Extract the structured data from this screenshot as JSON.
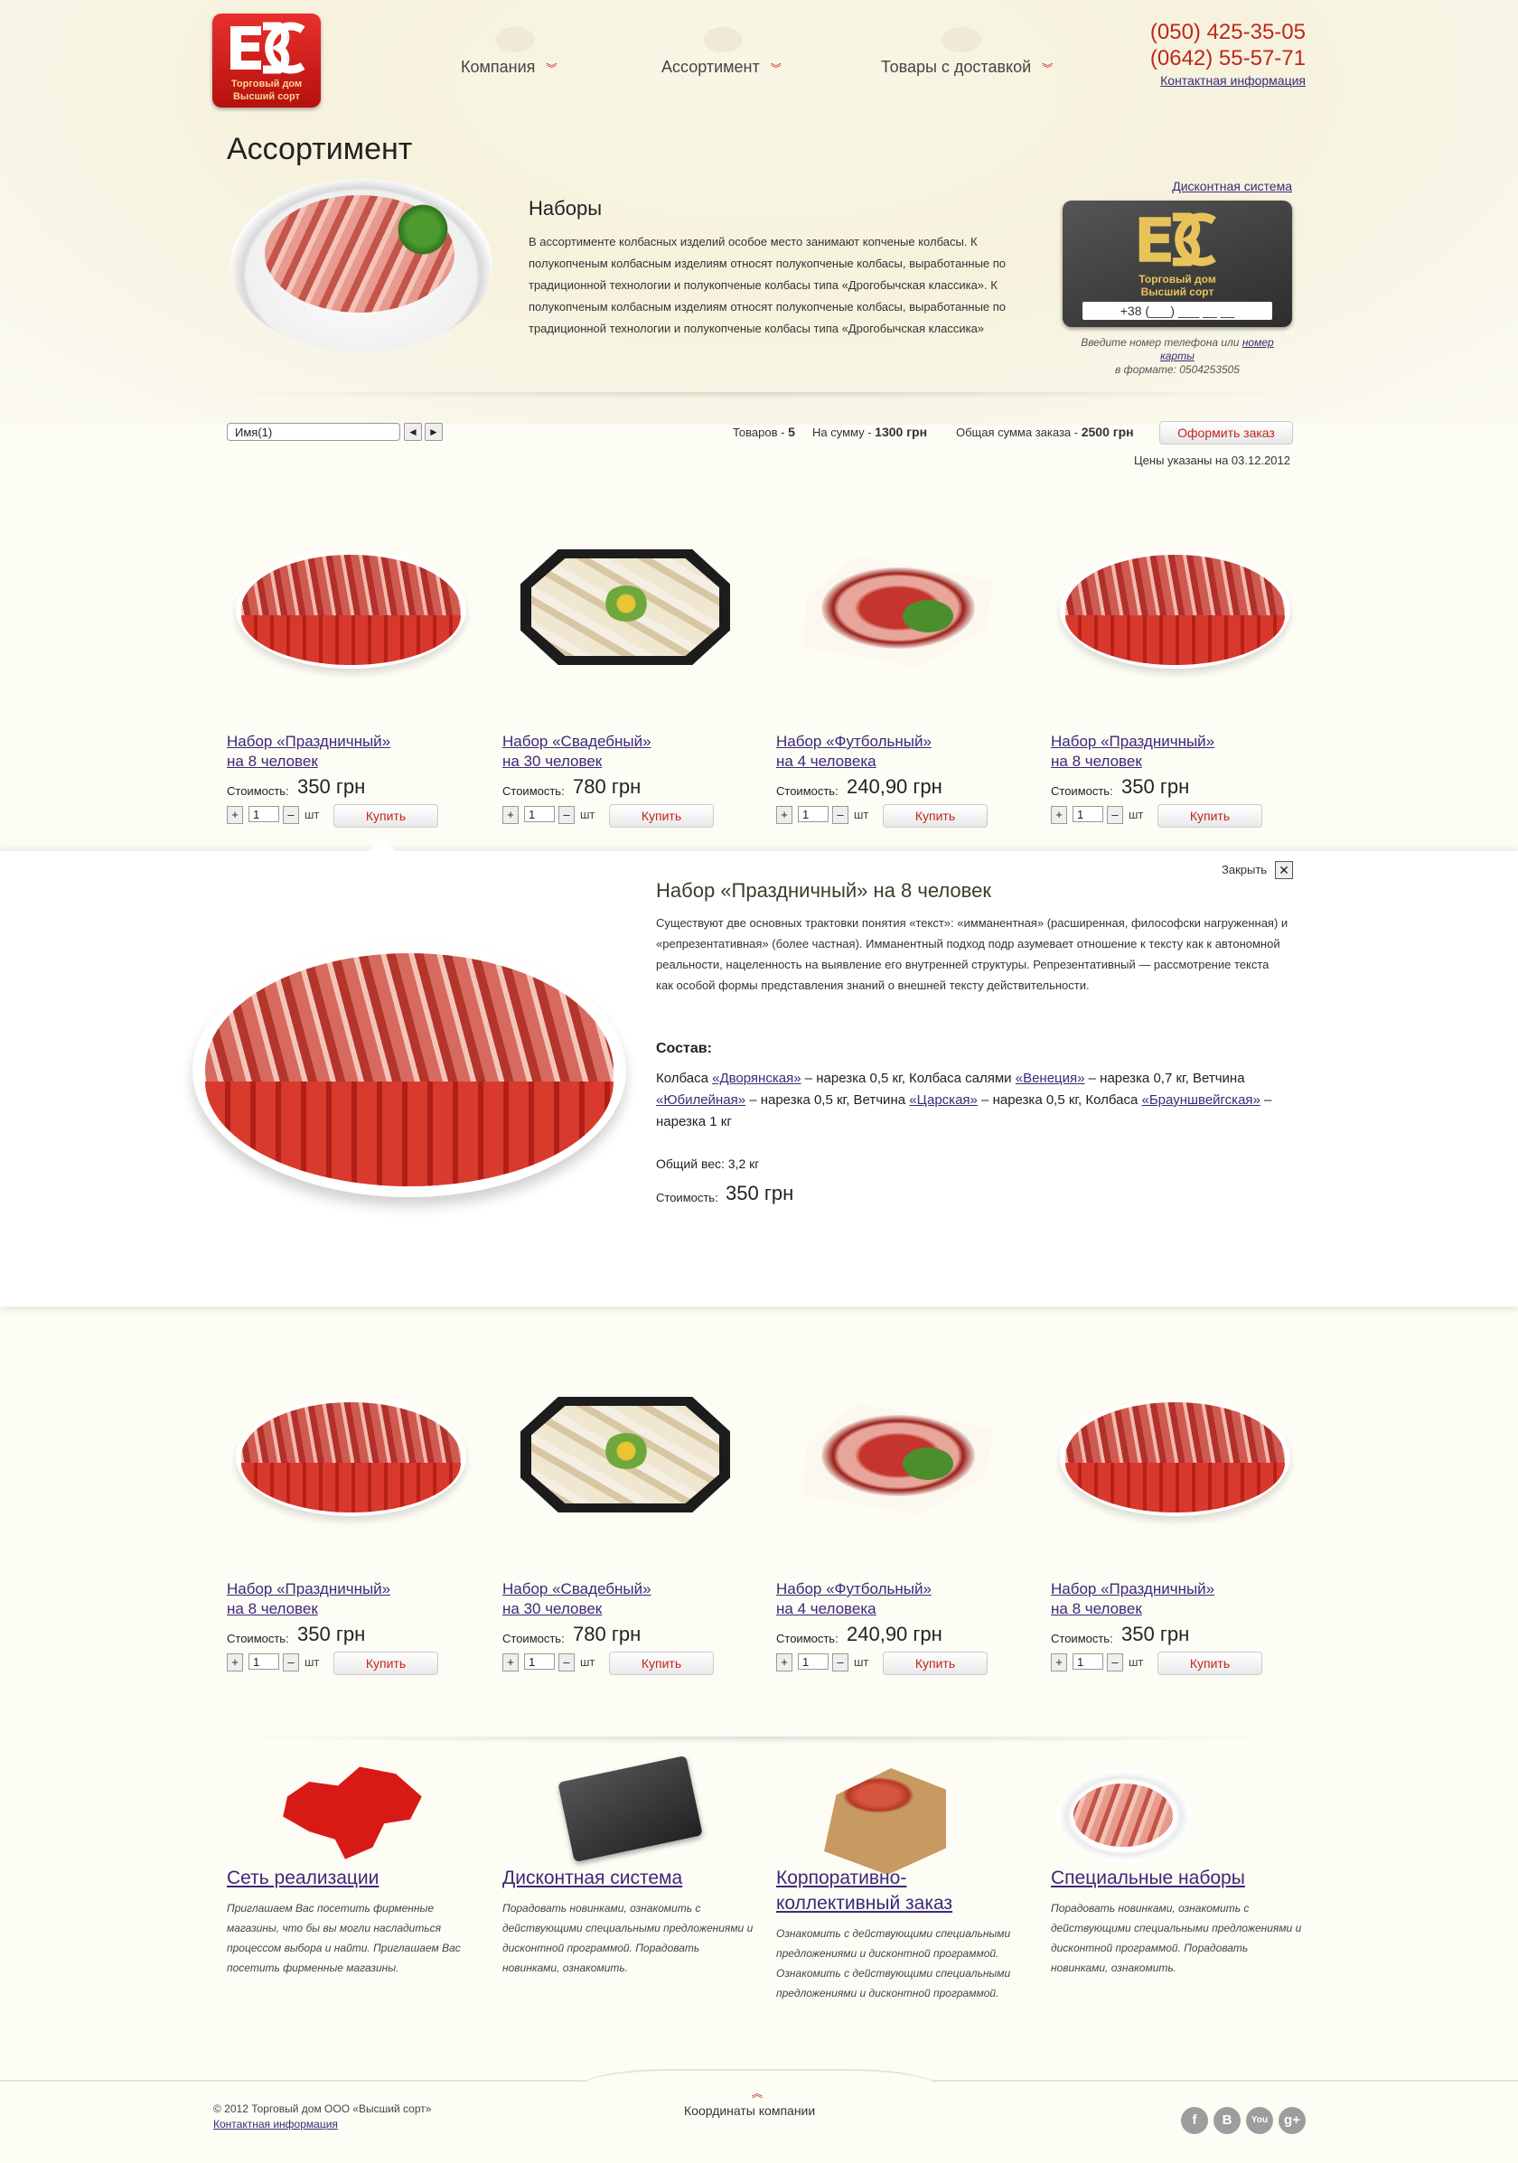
{
  "header": {
    "logo": {
      "line1": "Торговый дом",
      "line2": "Высший сорт"
    },
    "nav": [
      {
        "label": "Компания"
      },
      {
        "label": "Ассортимент"
      },
      {
        "label": "Товары с доставкой"
      }
    ],
    "phones": [
      "(050) 425-35-05",
      "(0642) 55-57-71"
    ],
    "contact_link": "Контактная информация"
  },
  "page_title": "Ассортимент",
  "section": {
    "title": "Наборы",
    "text": "В ассортименте колбасных изделий особое место занимают копченые колбасы. К полукопченым колбасным изделиям относят полукопченые колбасы, выработанные по традиционной технологии и полукопченые колбасы типа «Дрогобычская классика». К полукопченым колбасным изделиям относят полукопченые колбасы, выработанные по традиционной технологии и полукопченые колбасы типа «Дрогобычская классика»"
  },
  "discount": {
    "link": "Дисконтная система",
    "card_line1": "Торговый дом",
    "card_line2": "Высший сорт",
    "phone_placeholder": "+38 (___) ___ __ __",
    "hint_part1": "Введите номер телефона или",
    "hint_link": "номер карты",
    "hint_part2": "в формате: 0504253505"
  },
  "toolbar": {
    "sort_value": "Имя(1)",
    "prev_icon": "◄",
    "next_icon": "►",
    "goods_label": "Товаров -",
    "goods_count": "5",
    "sum_label": "На сумму -",
    "sum_value": "1300 грн",
    "total_label": "Общая сумма заказа -",
    "total_value": "2500 грн",
    "order_button": "Оформить заказ",
    "prices_date": "Цены указаны на 03.12.2012"
  },
  "products_row1": [
    {
      "name1": "Набор «Праздничный»",
      "name2": "на 8 человек",
      "cost_label": "Стоимость:",
      "cost": "350 грн",
      "qty": "1",
      "unit": "шт",
      "buy": "Купить",
      "img": "oval"
    },
    {
      "name1": "Набор «Свадебный»",
      "name2": "на 30 человек",
      "cost_label": "Стоимость:",
      "cost": "780 грн",
      "qty": "1",
      "unit": "шт",
      "buy": "Купить",
      "img": "tray"
    },
    {
      "name1": "Набор «Футбольный»",
      "name2": "на 4 человека",
      "cost_label": "Стоимость:",
      "cost": "240,90 грн",
      "qty": "1",
      "unit": "шт",
      "buy": "Купить",
      "img": "square"
    },
    {
      "name1": "Набор «Праздничный»",
      "name2": "на 8 человек",
      "cost_label": "Стоимость:",
      "cost": "350 грн",
      "qty": "1",
      "unit": "шт",
      "buy": "Купить",
      "img": "oval"
    }
  ],
  "products_row2": [
    {
      "name1": "Набор «Праздничный»",
      "name2": "на 8 человек",
      "cost_label": "Стоимость:",
      "cost": "350 грн",
      "qty": "1",
      "unit": "шт",
      "buy": "Купить",
      "img": "oval"
    },
    {
      "name1": "Набор «Свадебный»",
      "name2": "на 30 человек",
      "cost_label": "Стоимость:",
      "cost": "780 грн",
      "qty": "1",
      "unit": "шт",
      "buy": "Купить",
      "img": "tray"
    },
    {
      "name1": "Набор «Футбольный»",
      "name2": "на 4 человека",
      "cost_label": "Стоимость:",
      "cost": "240,90 грн",
      "qty": "1",
      "unit": "шт",
      "buy": "Купить",
      "img": "square"
    },
    {
      "name1": "Набор «Праздничный»",
      "name2": "на 8 человек",
      "cost_label": "Стоимость:",
      "cost": "350 грн",
      "qty": "1",
      "unit": "шт",
      "buy": "Купить",
      "img": "oval"
    }
  ],
  "detail": {
    "close_label": "Закрыть",
    "close_icon": "✕",
    "title": "Набор «Праздничный» на 8 человек",
    "text": "Существуют две основных трактовки понятия «текст»: «имманентная» (расширенная, философски нагруженная) и «репрезентативная» (более частная). Имманентный подход подр азумевает отношение к тексту как к автономной реальности, нацеленность на выявление его внутренней структуры. Репрезентативный — рассмотрение текста как особой формы представления знаний о внешней тексту действительности.",
    "composition_title": "Состав:",
    "composition": [
      {
        "t": "Колбаса "
      },
      {
        "l": "«Дворянская»"
      },
      {
        "t": " – нарезка 0,5 кг, Колбаса салями "
      },
      {
        "l": "«Венеция»"
      },
      {
        "t": " – нарезка 0,7 кг, Ветчина "
      },
      {
        "l": "«Юбилейная»"
      },
      {
        "t": " – нарезка 0,5 кг, Ветчина "
      },
      {
        "l": "«Царская»"
      },
      {
        "t": " – нарезка 0,5 кг, Колбаса "
      },
      {
        "l": "«Брауншвейгская»"
      },
      {
        "t": " – нарезка 1 кг"
      }
    ],
    "weight": "Общий вес: 3,2 кг",
    "cost_label": "Стоимость:",
    "cost": "350 грн"
  },
  "features": [
    {
      "title": "Сеть реализации",
      "text": "Приглашаем Вас посетить фирменные магазины, что бы вы могли насладиться процессом выбора и найти. Приглашаем Вас посетить фирменные магазины."
    },
    {
      "title": "Дисконтная система",
      "text": "Порадовать новинками, ознакомить с действующими специальными предложениями и дисконтной программой. Порадовать новинками, ознакомить."
    },
    {
      "title": "Корпоративно-коллективный заказ",
      "text": "Ознакомить с действующими специальными предложениями и дисконтной программой. Ознакомить с действующими специальными предложениями и дисконтной программой."
    },
    {
      "title": "Специальные наборы",
      "text": "Порадовать новинками, ознакомить с действующими специальными предложениями и дисконтной программой. Порадовать новинками, ознакомить."
    }
  ],
  "footer": {
    "copyright": "© 2012 Торговый дом ООО «Высший сорт»",
    "contact_link": "Контактная информация",
    "coords": "Координаты компании",
    "coords_icon": "︽",
    "social": [
      {
        "icon": "facebook-icon",
        "glyph": "f"
      },
      {
        "icon": "vkontakte-icon",
        "glyph": "B"
      },
      {
        "icon": "youtube-icon",
        "glyph": "You"
      },
      {
        "icon": "google-plus-icon",
        "glyph": "g+"
      }
    ]
  }
}
